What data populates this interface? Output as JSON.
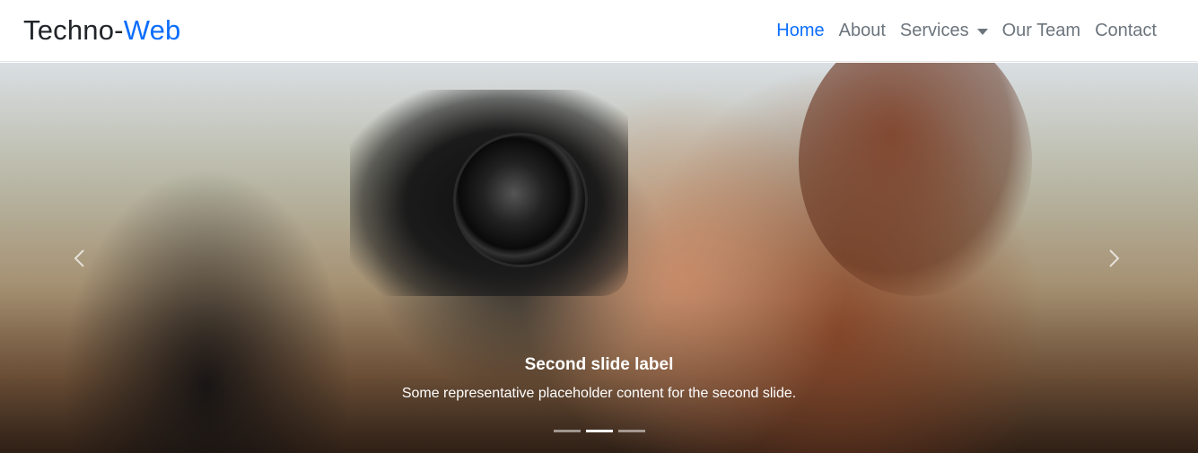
{
  "brand": {
    "part1": "Techno-",
    "part2": "Web"
  },
  "nav": {
    "items": [
      {
        "label": "Home",
        "active": true
      },
      {
        "label": "About"
      },
      {
        "label": "Services",
        "dropdown": true
      },
      {
        "label": "Our Team"
      },
      {
        "label": "Contact"
      }
    ]
  },
  "carousel": {
    "caption_title": "Second slide label",
    "caption_text": "Some representative placeholder content for the second slide.",
    "slide_count": 3,
    "active_index": 1,
    "prev_icon": "chevron-left-icon",
    "next_icon": "chevron-right-icon"
  },
  "colors": {
    "accent": "#0d6efd",
    "text": "#212529",
    "muted": "#6c757d"
  }
}
